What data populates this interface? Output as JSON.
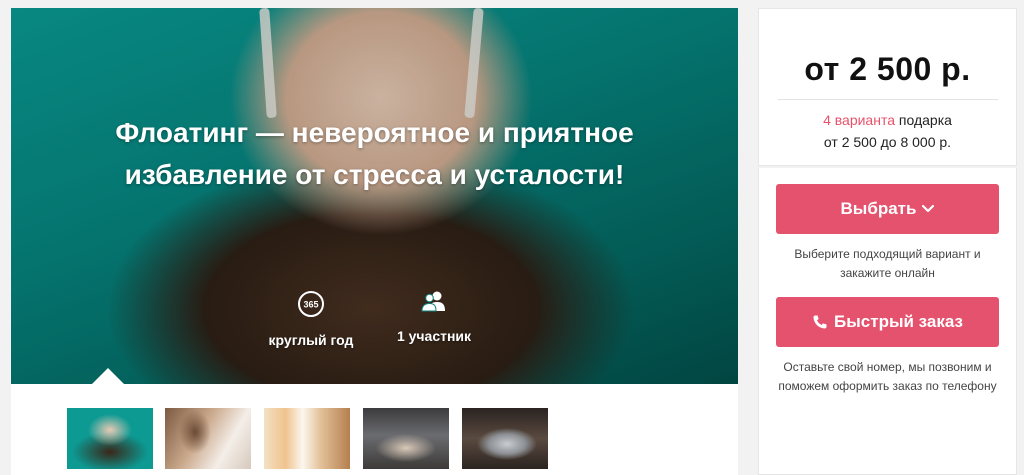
{
  "hero": {
    "title": "Флоатинг — невероятное и приятное избавление от стресса и усталости!",
    "features": [
      {
        "icon": "calendar-365-icon",
        "label": "круглый год"
      },
      {
        "icon": "participants-icon",
        "label": "1 участник"
      }
    ]
  },
  "thumbnails": [
    "floating-woman-thumb",
    "woman-relaxing-thumb",
    "spa-room-thumb",
    "float-pod-top-view-thumb",
    "float-capsule-thumb"
  ],
  "pricing": {
    "price": "от 2 500 р.",
    "variants_count": "4 варианта",
    "variants_text": "подарка",
    "range": "от 2 500 до 8 000 р."
  },
  "actions": {
    "choose_label": "Выбрать",
    "choose_hint": "Выберите подходящий вариант и закажите онлайн",
    "quick_order_label": "Быстрый заказ",
    "quick_order_hint": "Оставьте свой номер, мы позвоним и поможем оформить заказ по телефону"
  },
  "colors": {
    "accent": "#e5526e",
    "variants_accent": "#e8526b",
    "hero_water": "#0a9b94"
  }
}
